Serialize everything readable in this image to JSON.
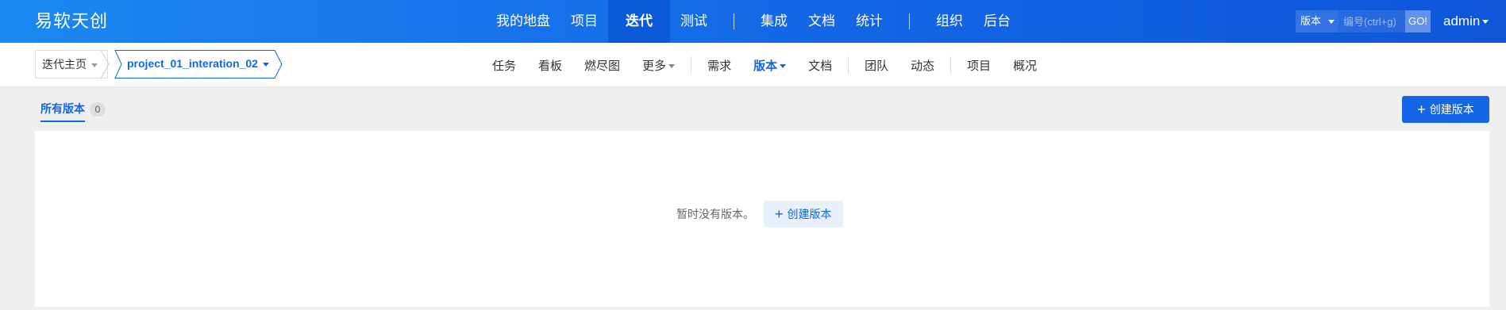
{
  "header": {
    "logo": "易软天创",
    "nav": [
      {
        "label": "我的地盘"
      },
      {
        "label": "项目"
      },
      {
        "label": "迭代",
        "active": true
      },
      {
        "label": "测试"
      },
      {
        "label": "集成"
      },
      {
        "label": "文档"
      },
      {
        "label": "统计"
      },
      {
        "label": "组织"
      },
      {
        "label": "后台"
      }
    ],
    "search": {
      "type": "版本",
      "placeholder": "编号(ctrl+g)",
      "go": "GO!"
    },
    "user": "admin"
  },
  "subheader": {
    "home_crumb": "迭代主页",
    "project_crumb": "project_01_interation_02",
    "nav": [
      {
        "label": "任务"
      },
      {
        "label": "看板"
      },
      {
        "label": "燃尽图"
      },
      {
        "label": "更多"
      },
      {
        "label": "需求"
      },
      {
        "label": "版本",
        "active": true
      },
      {
        "label": "文档"
      },
      {
        "label": "团队"
      },
      {
        "label": "动态"
      },
      {
        "label": "项目"
      },
      {
        "label": "概况"
      }
    ]
  },
  "content": {
    "tab_label": "所有版本",
    "tab_count": "0",
    "create_button": "创建版本",
    "empty_text": "暂时没有版本。",
    "empty_button": "创建版本"
  },
  "colors": {
    "primary": "#1466e6",
    "header_start": "#1b88f2",
    "header_end": "#0f56d9"
  }
}
